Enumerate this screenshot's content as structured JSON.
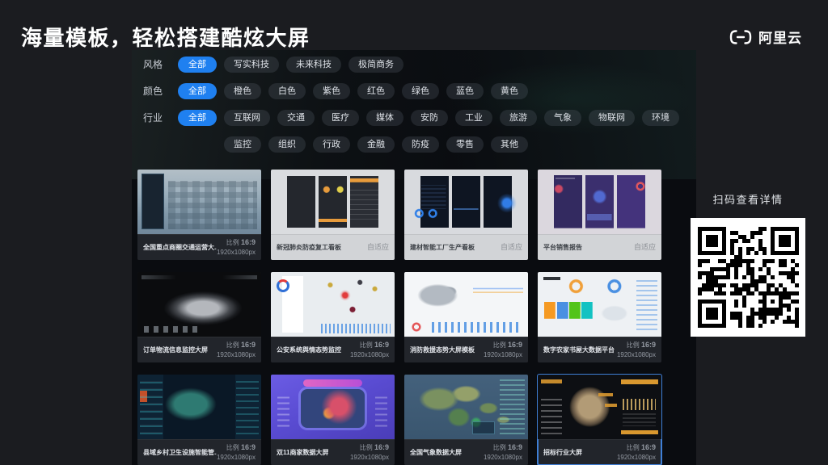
{
  "header": {
    "title": "海量模板，轻松搭建酷炫大屏",
    "brand": "阿里云"
  },
  "filters": {
    "rows": [
      {
        "label": "风格",
        "selected": 0,
        "options": [
          "全部",
          "写实科技",
          "未来科技",
          "极简商务"
        ]
      },
      {
        "label": "颜色",
        "selected": 0,
        "options": [
          "全部",
          "橙色",
          "白色",
          "紫色",
          "红色",
          "绿色",
          "蓝色",
          "黄色"
        ]
      },
      {
        "label": "行业",
        "selected": 0,
        "options": [
          "全部",
          "互联网",
          "交通",
          "医疗",
          "媒体",
          "安防",
          "工业",
          "旅游",
          "气象",
          "物联网",
          "环境",
          "监控",
          "组织",
          "行政",
          "金融",
          "防疫",
          "零售",
          "其他"
        ]
      }
    ]
  },
  "cards": [
    {
      "name": "全国重点商圈交通运营大...",
      "meta_type": "ratio",
      "ratio_prefix": "比例",
      "ratio": "16:9",
      "size": "1920x1080px",
      "thumb": "city",
      "label_theme": "dark",
      "selected": false
    },
    {
      "name": "新冠肺炎防疫复工看板",
      "meta_type": "adaptive",
      "adaptive_label": "自适应",
      "thumb": "covid",
      "label_theme": "light",
      "selected": false
    },
    {
      "name": "建材智能工厂生产看板",
      "meta_type": "adaptive",
      "adaptive_label": "自适应",
      "thumb": "factory",
      "label_theme": "light",
      "selected": false
    },
    {
      "name": "平台销售报告",
      "meta_type": "adaptive",
      "adaptive_label": "自适应",
      "thumb": "sales",
      "label_theme": "light",
      "selected": false
    },
    {
      "name": "订单物流信息监控大屏",
      "meta_type": "ratio",
      "ratio_prefix": "比例",
      "ratio": "16:9",
      "size": "1920x1080px",
      "thumb": "logistics",
      "label_theme": "dark",
      "selected": false
    },
    {
      "name": "公安系统舆情态势监控",
      "meta_type": "ratio",
      "ratio_prefix": "比例",
      "ratio": "16:9",
      "size": "1920x1080px",
      "thumb": "police",
      "label_theme": "dark",
      "selected": false
    },
    {
      "name": "消防救援态势大屏模板",
      "meta_type": "ratio",
      "ratio_prefix": "比例",
      "ratio": "16:9",
      "size": "1920x1080px",
      "thumb": "fire",
      "label_theme": "dark",
      "selected": false
    },
    {
      "name": "数字农家书屋大数据平台",
      "meta_type": "ratio",
      "ratio_prefix": "比例",
      "ratio": "16:9",
      "size": "1920x1080px",
      "thumb": "books",
      "label_theme": "dark",
      "selected": false
    },
    {
      "name": "县域乡村卫生设施智能管...",
      "meta_type": "ratio",
      "ratio_prefix": "比例",
      "ratio": "16:9",
      "size": "1920x1080px",
      "thumb": "village",
      "label_theme": "dark",
      "selected": false
    },
    {
      "name": "双11商家数据大屏",
      "meta_type": "ratio",
      "ratio_prefix": "比例",
      "ratio": "16:9",
      "size": "1920x1080px",
      "thumb": "double11",
      "label_theme": "dark",
      "selected": false
    },
    {
      "name": "全国气象数据大屏",
      "meta_type": "ratio",
      "ratio_prefix": "比例",
      "ratio": "16:9",
      "size": "1920x1080px",
      "thumb": "weather",
      "label_theme": "dark",
      "selected": false
    },
    {
      "name": "招标行业大屏",
      "meta_type": "ratio",
      "ratio_prefix": "比例",
      "ratio": "16:9",
      "size": "1920x1080px",
      "thumb": "globe",
      "label_theme": "dark",
      "selected": true
    }
  ],
  "qr": {
    "caption": "扫码查看详情"
  },
  "colors": {
    "accent": "#1f80f0",
    "selected_border": "#3f7fd6"
  }
}
